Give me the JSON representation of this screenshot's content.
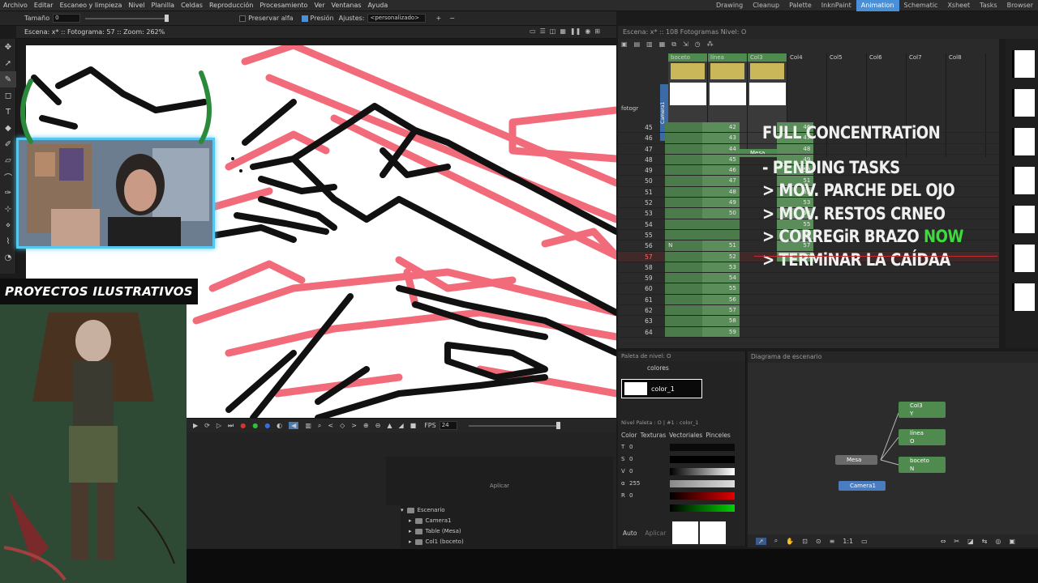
{
  "menubar": {
    "items": [
      "Archivo",
      "Editar",
      "Escaneo y limpieza",
      "Nivel",
      "Planilla",
      "Celdas",
      "Reproducción",
      "Procesamiento",
      "Ver",
      "Ventanas",
      "Ayuda"
    ],
    "rooms": [
      "Drawing",
      "Cleanup",
      "Palette",
      "InknPaint",
      "Animation",
      "Schematic",
      "Xsheet",
      "Tasks",
      "Browser"
    ],
    "active_room": "Animation"
  },
  "tool_options": {
    "size_label": "Tamaño",
    "size_value": "0",
    "preserve_alpha_label": "Preservar alfa",
    "pressure_label": "Presión",
    "settings_label": "Ajustes:",
    "settings_value": "<personalizado>"
  },
  "viewer": {
    "header": "Escena: x*  ::  Fotograma: 57  ::  Zoom: 262%",
    "fps_label": "FPS",
    "fps_value": "24"
  },
  "stream": {
    "brand": "PROYECTOS ILUSTRATIVOS"
  },
  "xsheet": {
    "header": "Escena: x*  ::  108 Fotogramas  Nivel: O",
    "fotogr_label": "fotogr",
    "camera_label": "Camera1",
    "columns": [
      {
        "name": "boceto",
        "level": true
      },
      {
        "name": "línea",
        "level": true
      },
      {
        "name": "Col3",
        "level": true
      },
      {
        "name": "Col4",
        "level": false
      },
      {
        "name": "Col5",
        "level": false
      },
      {
        "name": "Col6",
        "level": false
      },
      {
        "name": "Col7",
        "level": false
      },
      {
        "name": "Col8",
        "level": false
      }
    ],
    "mesa_label": "Mesa",
    "current_frame": "57",
    "rows": [
      {
        "f": "45",
        "c1": "42",
        "c3": "46"
      },
      {
        "f": "46",
        "c1": "43",
        "c3": "47"
      },
      {
        "f": "47",
        "c1": "44",
        "c3": "48"
      },
      {
        "f": "48",
        "c1": "45",
        "c3": "49"
      },
      {
        "f": "49",
        "c1": "46",
        "c3": "50"
      },
      {
        "f": "50",
        "c1": "47",
        "c3": "51"
      },
      {
        "f": "51",
        "c1": "48",
        "c3": "52"
      },
      {
        "f": "52",
        "c1": "49",
        "c3": "53"
      },
      {
        "f": "53",
        "c1": "50",
        "c3": "54"
      },
      {
        "f": "54",
        "c1": "",
        "c3": "55"
      },
      {
        "f": "55",
        "c1": "",
        "c3": "56"
      },
      {
        "f": "56",
        "c1": "51",
        "c0": "N",
        "c3": "57"
      },
      {
        "f": "57",
        "c1": "52",
        "c3": "58"
      },
      {
        "f": "58",
        "c1": "53",
        "c3": ""
      },
      {
        "f": "59",
        "c1": "54",
        "c3": ""
      },
      {
        "f": "60",
        "c1": "55",
        "c3": ""
      },
      {
        "f": "61",
        "c1": "56",
        "c3": ""
      },
      {
        "f": "62",
        "c1": "57",
        "c3": ""
      },
      {
        "f": "63",
        "c1": "58",
        "c3": ""
      },
      {
        "f": "64",
        "c1": "59",
        "c3": ""
      }
    ]
  },
  "notes": {
    "title": "FULL CONCENTRATiON",
    "line1": "- PENDING TASKS",
    "line2": "> MOV. PARCHE DEL OJO",
    "line3": "> MOV. RESTOS CRNEO",
    "line4_prefix": "> CORREGiR BRAZO ",
    "line4_now": "NOW",
    "line5": "> TERMiNAR LA CAÍDAA"
  },
  "palette": {
    "title": "Paleta de nivel: O",
    "page_name": "colores",
    "color_name": "color_1",
    "info": "Nivel Paleta : O | #1 : color_1",
    "tabs": [
      "Color",
      "Texturas",
      "Vectoriales",
      "Pinceles"
    ],
    "channels": [
      {
        "label": "T",
        "value": "0"
      },
      {
        "label": "S",
        "value": "0"
      },
      {
        "label": "V",
        "value": "0"
      },
      {
        "label": "α",
        "value": "255"
      },
      {
        "label": "R",
        "value": "0"
      }
    ],
    "auto_label": "Auto",
    "apply_label": "Aplicar"
  },
  "schematic": {
    "title": "Diagrama de escenario",
    "nodes": {
      "col3": "Col3",
      "col3_sub": "Y",
      "linea": "línea",
      "linea_sub": "O",
      "boceto": "boceto",
      "boceto_sub": "N",
      "mesa": "Mesa",
      "camera": "Camera1"
    }
  },
  "scene_tree": {
    "apply_label": "Aplicar",
    "items": [
      "Escenario",
      "Camera1",
      "Table (Mesa)",
      "Col1 (boceto)"
    ]
  }
}
